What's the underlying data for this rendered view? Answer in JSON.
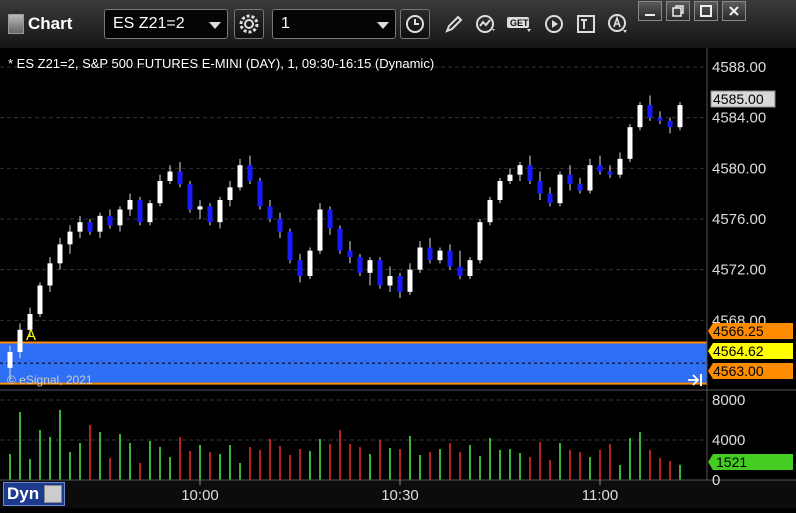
{
  "toolbar": {
    "app_title": "Chart",
    "symbol": "ES Z21=2",
    "interval": "1",
    "get_label": "GET"
  },
  "chart": {
    "header": "* ES Z21=2, S&P 500 FUTURES E-MINI (DAY), 1, 09:30-16:15 (Dynamic)",
    "copyright": "© eSignal, 2021",
    "annotation_label": "A",
    "colors": {
      "up": "#ffffff",
      "down": "#1a1aff",
      "band": "#2f6ff5",
      "band_line": "#ff8c00",
      "last_tag": "#ffff00",
      "vol_up": "#3cb43c",
      "vol_down": "#b42323",
      "vol_tag": "#44cc22"
    },
    "price_axis": {
      "labels": [
        "4588.00",
        "4584.00",
        "4580.00",
        "4576.00",
        "4572.00",
        "4568.00"
      ],
      "values": [
        4588,
        4584,
        4580,
        4576,
        4572,
        4568
      ],
      "ylim": [
        4562.5,
        4589.5
      ]
    },
    "time_axis": {
      "labels": [
        "10:00",
        "10:30",
        "11:00"
      ]
    },
    "tags": {
      "band_top": "4566.25",
      "band_bottom": "4563.00",
      "last_price": "4564.62",
      "current": "4585.00"
    },
    "band": {
      "top": 4566.25,
      "bottom": 4563.0
    },
    "volume_axis": {
      "labels": [
        "8000",
        "4000",
        "0"
      ],
      "values": [
        8000,
        4000,
        0
      ],
      "ylim": [
        0,
        9000
      ]
    },
    "volume_tag": "1521",
    "footer": {
      "dyn_label": "Dyn"
    }
  },
  "chart_data": {
    "type": "candlestick",
    "symbol": "ES Z21=2",
    "interval_minutes": 1,
    "time_axis_labels": [
      "10:00",
      "10:30",
      "11:00"
    ],
    "candles": [
      [
        4564.25,
        4566.0,
        4563.25,
        4565.5
      ],
      [
        4565.5,
        4567.75,
        4565.0,
        4567.25
      ],
      [
        4567.25,
        4569.0,
        4566.75,
        4568.5
      ],
      [
        4568.5,
        4571.0,
        4568.25,
        4570.75
      ],
      [
        4570.75,
        4573.0,
        4570.25,
        4572.5
      ],
      [
        4572.5,
        4574.5,
        4572.0,
        4574.0
      ],
      [
        4574.0,
        4575.5,
        4573.25,
        4575.0
      ],
      [
        4575.0,
        4576.25,
        4574.5,
        4575.75
      ],
      [
        4575.75,
        4576.0,
        4574.75,
        4575.0
      ],
      [
        4575.0,
        4576.5,
        4574.5,
        4576.25
      ],
      [
        4576.25,
        4576.75,
        4575.25,
        4575.5
      ],
      [
        4575.5,
        4577.0,
        4575.0,
        4576.75
      ],
      [
        4576.75,
        4578.0,
        4576.25,
        4577.5
      ],
      [
        4577.5,
        4577.75,
        4575.5,
        4575.75
      ],
      [
        4575.75,
        4577.5,
        4575.5,
        4577.25
      ],
      [
        4577.25,
        4579.5,
        4577.0,
        4579.0
      ],
      [
        4579.0,
        4580.25,
        4578.75,
        4579.75
      ],
      [
        4579.75,
        4580.5,
        4578.5,
        4578.75
      ],
      [
        4578.75,
        4579.0,
        4576.5,
        4576.75
      ],
      [
        4576.75,
        4577.5,
        4576.0,
        4577.0
      ],
      [
        4577.0,
        4577.25,
        4575.5,
        4575.75
      ],
      [
        4575.75,
        4577.75,
        4575.25,
        4577.5
      ],
      [
        4577.5,
        4579.0,
        4577.0,
        4578.5
      ],
      [
        4578.5,
        4580.75,
        4578.25,
        4580.25
      ],
      [
        4580.25,
        4581.0,
        4578.75,
        4579.0
      ],
      [
        4579.0,
        4579.25,
        4576.75,
        4577.0
      ],
      [
        4577.0,
        4577.5,
        4575.75,
        4576.0
      ],
      [
        4576.0,
        4576.5,
        4574.5,
        4575.0
      ],
      [
        4575.0,
        4575.25,
        4572.5,
        4572.75
      ],
      [
        4572.75,
        4573.25,
        4571.0,
        4571.5
      ],
      [
        4571.5,
        4573.75,
        4571.25,
        4573.5
      ],
      [
        4573.5,
        4577.25,
        4573.25,
        4576.75
      ],
      [
        4576.75,
        4577.0,
        4574.75,
        4575.25
      ],
      [
        4575.25,
        4575.5,
        4573.25,
        4573.5
      ],
      [
        4573.5,
        4574.25,
        4572.5,
        4573.0
      ],
      [
        4573.0,
        4573.25,
        4571.5,
        4571.75
      ],
      [
        4571.75,
        4573.0,
        4570.75,
        4572.75
      ],
      [
        4572.75,
        4573.0,
        4570.5,
        4570.75
      ],
      [
        4570.75,
        4572.25,
        4570.25,
        4571.5
      ],
      [
        4571.5,
        4571.75,
        4569.75,
        4570.25
      ],
      [
        4570.25,
        4572.5,
        4570.0,
        4572.0
      ],
      [
        4572.0,
        4574.25,
        4571.75,
        4573.75
      ],
      [
        4573.75,
        4574.5,
        4572.5,
        4572.75
      ],
      [
        4572.75,
        4573.75,
        4572.5,
        4573.5
      ],
      [
        4573.5,
        4574.0,
        4572.0,
        4572.25
      ],
      [
        4572.25,
        4573.5,
        4571.25,
        4571.5
      ],
      [
        4571.5,
        4573.0,
        4571.25,
        4572.75
      ],
      [
        4572.75,
        4576.0,
        4572.5,
        4575.75
      ],
      [
        4575.75,
        4577.75,
        4575.5,
        4577.5
      ],
      [
        4577.5,
        4579.25,
        4577.25,
        4579.0
      ],
      [
        4579.0,
        4580.0,
        4578.75,
        4579.5
      ],
      [
        4579.5,
        4580.5,
        4579.0,
        4580.25
      ],
      [
        4580.25,
        4581.0,
        4578.75,
        4579.0
      ],
      [
        4579.0,
        4579.75,
        4577.5,
        4578.0
      ],
      [
        4578.0,
        4578.5,
        4577.0,
        4577.25
      ],
      [
        4577.25,
        4579.75,
        4577.0,
        4579.5
      ],
      [
        4579.5,
        4580.25,
        4578.25,
        4578.75
      ],
      [
        4578.75,
        4579.25,
        4578.0,
        4578.25
      ],
      [
        4578.25,
        4580.75,
        4578.0,
        4580.25
      ],
      [
        4580.25,
        4581.0,
        4579.5,
        4579.75
      ],
      [
        4579.75,
        4580.25,
        4579.25,
        4579.5
      ],
      [
        4579.5,
        4581.25,
        4579.25,
        4580.75
      ],
      [
        4580.75,
        4583.5,
        4580.5,
        4583.25
      ],
      [
        4583.25,
        4585.25,
        4583.0,
        4585.0
      ],
      [
        4585.0,
        4585.75,
        4583.75,
        4584.0
      ],
      [
        4584.0,
        4584.5,
        4583.5,
        4583.75
      ],
      [
        4583.75,
        4584.0,
        4582.75,
        4583.25
      ],
      [
        4583.25,
        4585.25,
        4583.0,
        4585.0
      ]
    ],
    "volume": [
      2600,
      6800,
      2100,
      5000,
      4300,
      7000,
      2800,
      3700,
      5500,
      4800,
      2200,
      4600,
      3700,
      1700,
      3900,
      3300,
      2300,
      4300,
      2900,
      3500,
      2800,
      2600,
      3500,
      1700,
      3300,
      3000,
      4100,
      3400,
      2500,
      3100,
      2900,
      4100,
      3600,
      5000,
      3600,
      3300,
      2600,
      4000,
      3200,
      3100,
      4400,
      2500,
      2800,
      3100,
      3700,
      2800,
      3500,
      2400,
      4200,
      3000,
      3100,
      2700,
      2300,
      3800,
      2000,
      3700,
      3000,
      2800,
      2300,
      3000,
      3600,
      1500,
      4200,
      4800,
      3000,
      2200,
      1900,
      1521
    ],
    "ylim": [
      4562.5,
      4589.5
    ],
    "volume_ylim": [
      0,
      9000
    ]
  }
}
